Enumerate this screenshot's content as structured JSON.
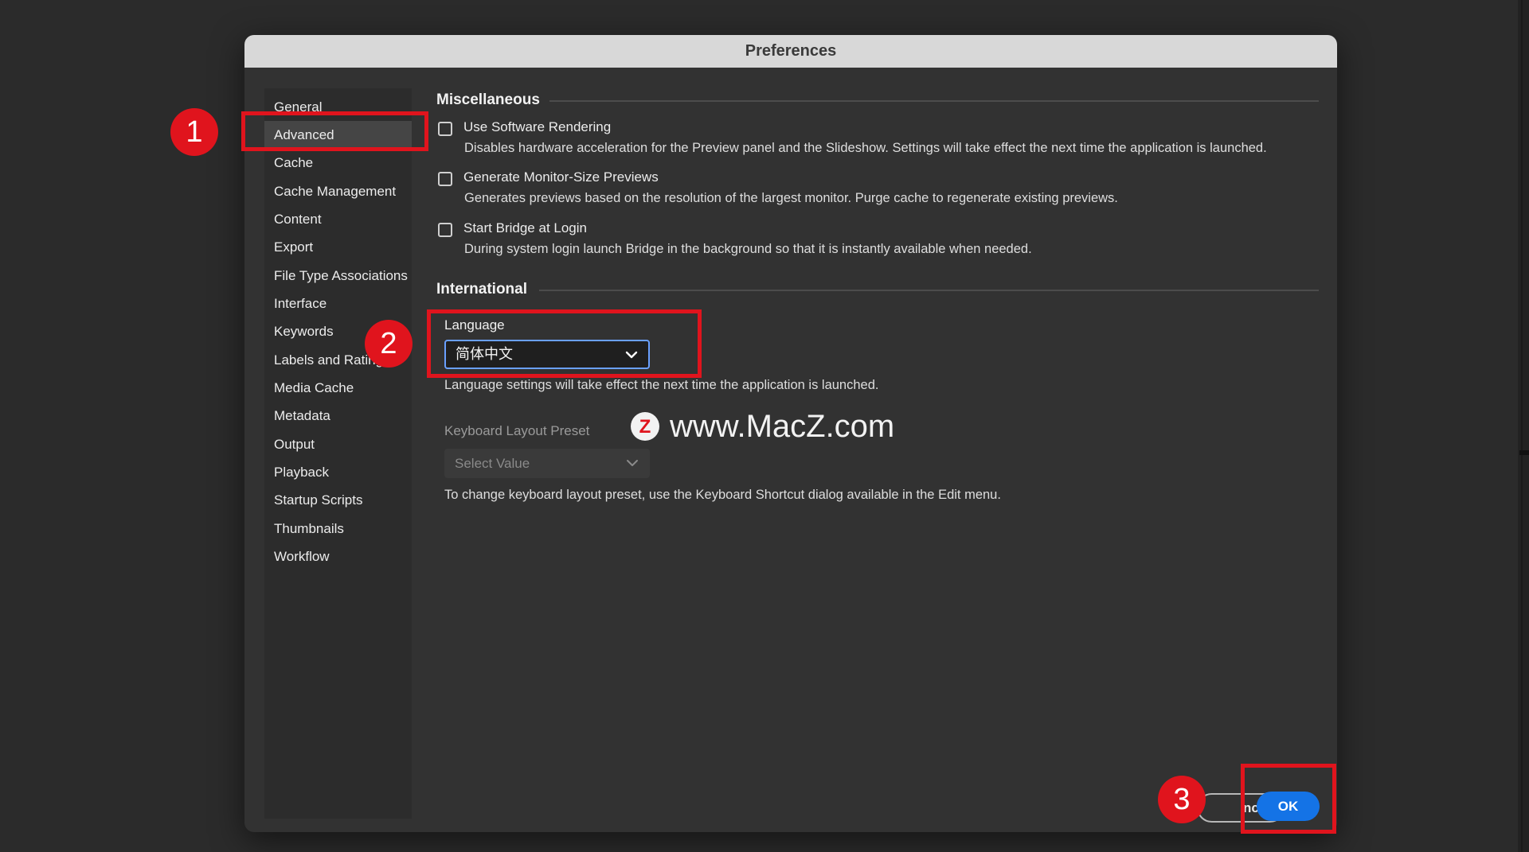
{
  "dialog": {
    "title": "Preferences"
  },
  "sidebar": {
    "items": [
      {
        "label": "General"
      },
      {
        "label": "Advanced",
        "selected": true
      },
      {
        "label": "Cache"
      },
      {
        "label": "Cache Management"
      },
      {
        "label": "Content"
      },
      {
        "label": "Export"
      },
      {
        "label": "File Type Associations"
      },
      {
        "label": "Interface"
      },
      {
        "label": "Keywords"
      },
      {
        "label": "Labels and Rating"
      },
      {
        "label": "Media Cache"
      },
      {
        "label": "Metadata"
      },
      {
        "label": "Output"
      },
      {
        "label": "Playback"
      },
      {
        "label": "Startup Scripts"
      },
      {
        "label": "Thumbnails"
      },
      {
        "label": "Workflow"
      }
    ]
  },
  "miscellaneous": {
    "header": "Miscellaneous",
    "options": [
      {
        "label": "Use Software Rendering",
        "checked": false,
        "description": "Disables hardware acceleration for the Preview panel and the Slideshow. Settings will take effect the next time the application is launched."
      },
      {
        "label": "Generate Monitor-Size Previews",
        "checked": false,
        "description": "Generates previews based on the resolution of the largest monitor.  Purge cache to regenerate existing previews."
      },
      {
        "label": "Start Bridge at Login",
        "checked": false,
        "description": "During system login launch Bridge in the background so that it is instantly available when needed."
      }
    ]
  },
  "international": {
    "header": "International",
    "language_label": "Language",
    "language_value": "简体中文",
    "language_hint": "Language settings will take effect the next time the application is launched.",
    "keyboard_label": "Keyboard Layout Preset",
    "keyboard_value": "Select Value",
    "keyboard_hint": "To change keyboard layout preset, use the Keyboard Shortcut dialog available in the Edit menu."
  },
  "footer": {
    "cancel_label": "ncel",
    "ok_label": "OK"
  },
  "annotations": {
    "step1": "1",
    "step2": "2",
    "step3": "3",
    "highlight_color": "#e0141d"
  },
  "watermark": {
    "logo_letter": "Z",
    "text": "www.MacZ.com"
  },
  "colors": {
    "accent": "#1473e6",
    "focus": "#6aa0ff"
  }
}
